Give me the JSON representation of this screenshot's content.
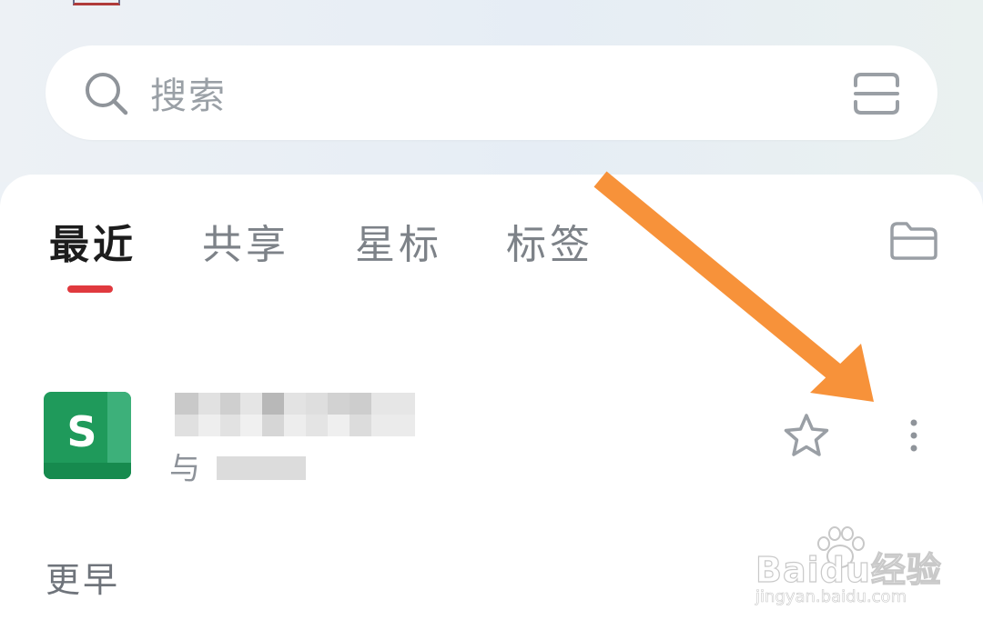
{
  "search": {
    "placeholder": "搜索"
  },
  "tabs": [
    {
      "label": "最近",
      "active": true
    },
    {
      "label": "共享",
      "active": false
    },
    {
      "label": "星标",
      "active": false
    },
    {
      "label": "标签",
      "active": false
    }
  ],
  "recent_file": {
    "type_letter": "S",
    "meta_prefix": "与"
  },
  "sections": {
    "earlier": "更早"
  },
  "icons": {
    "search": "search-icon",
    "scan": "scan-icon",
    "folder": "folder-icon",
    "star": "star-icon",
    "more": "more-vertical-icon"
  },
  "colors": {
    "accent": "#e0393e",
    "annotation_arrow": "#f7923a",
    "sheet_green": "#1f9a5b"
  },
  "watermark": {
    "brand": "Baidu经验",
    "url": "jingyan.baidu.com"
  }
}
